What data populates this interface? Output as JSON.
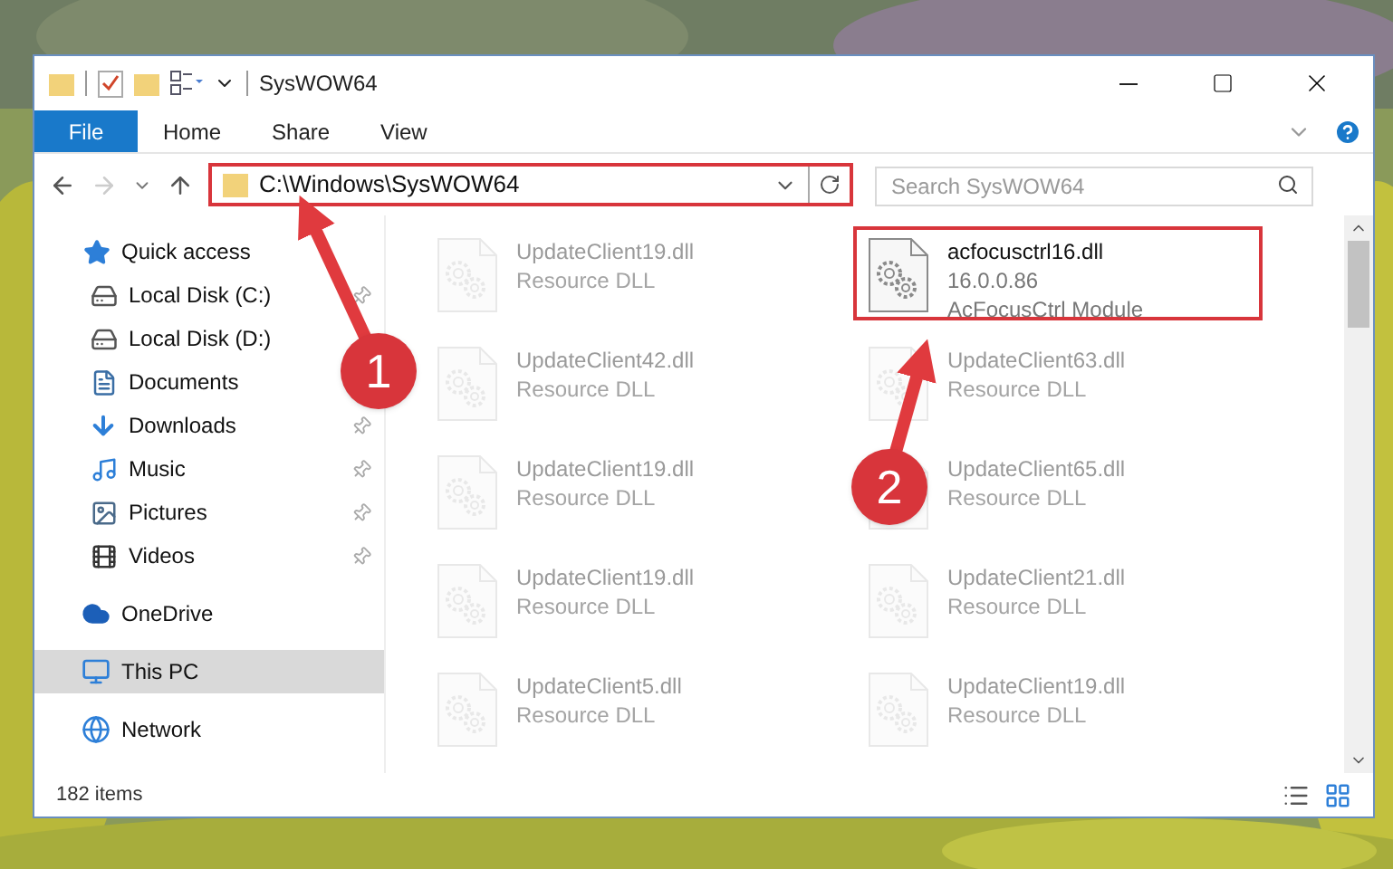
{
  "window": {
    "title": "SysWOW64"
  },
  "ribbon_tabs": [
    {
      "label": "File",
      "kind": "file"
    },
    {
      "label": "Home",
      "kind": "tab"
    },
    {
      "label": "Share",
      "kind": "tab"
    },
    {
      "label": "View",
      "kind": "tab"
    }
  ],
  "address": {
    "path": "C:\\Windows\\SysWOW64",
    "highlighted": true
  },
  "search": {
    "placeholder": "Search SysWOW64"
  },
  "navigation": [
    {
      "label": "Quick access",
      "selected": false,
      "children": [
        {
          "label": "Local Disk (C:)",
          "pinned": true
        },
        {
          "label": "Local Disk (D:)",
          "pinned": false
        },
        {
          "label": "Documents",
          "pinned": false
        },
        {
          "label": "Downloads",
          "pinned": true
        },
        {
          "label": "Music",
          "pinned": true
        },
        {
          "label": "Pictures",
          "pinned": true
        },
        {
          "label": "Videos",
          "pinned": true
        }
      ]
    },
    {
      "label": "OneDrive",
      "selected": false
    },
    {
      "label": "This PC",
      "selected": true
    },
    {
      "label": "Network",
      "selected": false
    }
  ],
  "files": [
    {
      "name": "UpdateClient19.dll",
      "lines": [
        "Resource DLL"
      ],
      "faded": true,
      "highlighted": false
    },
    {
      "name": "acfocusctrl16.dll",
      "lines": [
        "16.0.0.86",
        "AcFocusCtrl Module"
      ],
      "faded": false,
      "highlighted": true
    },
    {
      "name": "UpdateClient42.dll",
      "lines": [
        "Resource DLL"
      ],
      "faded": true,
      "highlighted": false
    },
    {
      "name": "UpdateClient63.dll",
      "lines": [
        "Resource DLL"
      ],
      "faded": true,
      "highlighted": false
    },
    {
      "name": "UpdateClient19.dll",
      "lines": [
        "Resource DLL"
      ],
      "faded": true,
      "highlighted": false
    },
    {
      "name": "UpdateClient65.dll",
      "lines": [
        "Resource DLL"
      ],
      "faded": true,
      "highlighted": false
    },
    {
      "name": "UpdateClient19.dll",
      "lines": [
        "Resource DLL"
      ],
      "faded": true,
      "highlighted": false
    },
    {
      "name": "UpdateClient21.dll",
      "lines": [
        "Resource DLL"
      ],
      "faded": true,
      "highlighted": false
    },
    {
      "name": "UpdateClient5.dll",
      "lines": [
        "Resource DLL"
      ],
      "faded": true,
      "highlighted": false
    },
    {
      "name": "UpdateClient19.dll",
      "lines": [
        "Resource DLL"
      ],
      "faded": true,
      "highlighted": false
    }
  ],
  "status_bar": {
    "item_count": "182 items"
  },
  "annotations": [
    {
      "number": "1"
    },
    {
      "number": "2"
    }
  ]
}
